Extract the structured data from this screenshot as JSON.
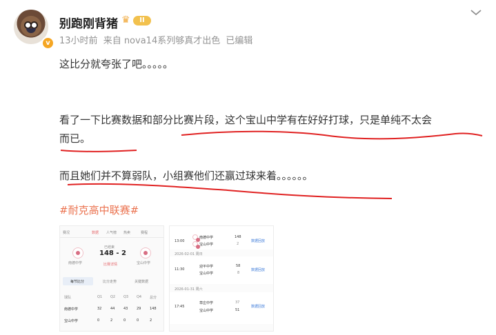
{
  "post": {
    "username": "别跑刚背猪",
    "badge_level": "II",
    "time": "13小时前",
    "from": "来自 nova14系列够真才出色",
    "edited": "已编辑",
    "lines": [
      "这比分就夸张了吧。。。。。",
      "看了一下比赛数据和部分比赛片段，这个宝山中学有在好好打球，只是单纯不太会",
      "而已。",
      "而且她们并不算弱队，小组赛他们还赢过球来着。。。。。。"
    ],
    "hashtag": "#耐克高中联赛#"
  },
  "img1": {
    "tabs": [
      "赛况",
      "数据",
      "人气榜",
      "热卖",
      "赛程"
    ],
    "status": "已结束",
    "score": "148 - 2",
    "left_team": "南德中学",
    "right_team": "宝山中学",
    "tag": "比赛详情",
    "stat_tabs": [
      "每节比分",
      "比分走势",
      "关键数据"
    ],
    "table_headers": [
      "球队",
      "Q1",
      "Q2",
      "Q3",
      "Q4",
      "总分"
    ],
    "rows": [
      {
        "team": "南德中学",
        "q1": "32",
        "q2": "44",
        "q3": "43",
        "q4": "29",
        "total": "148"
      },
      {
        "team": "宝山中学",
        "q1": "0",
        "q2": "2",
        "q3": "0",
        "q4": "0",
        "total": "2"
      }
    ]
  },
  "img2": {
    "blocks": [
      {
        "date": "",
        "time": "13:00",
        "team1": "南德中学",
        "team2": "宝山中学",
        "score1": "148",
        "score2": "2",
        "link": "数据回放"
      },
      {
        "date": "2026-02-01 周日",
        "time": "11:30",
        "team1": "迎平中学",
        "team2": "宝山中学",
        "score1": "58",
        "score2": "8",
        "link": "数据回放"
      },
      {
        "date": "2026-01-31 周六",
        "time": "17:45",
        "team1": "草庄中学",
        "team2": "宝山中学",
        "score1": "37",
        "score2": "51",
        "link": "数据回放"
      }
    ]
  },
  "colors": {
    "accent": "#eb7350",
    "annotation": "#e02020",
    "meta": "#939393"
  }
}
